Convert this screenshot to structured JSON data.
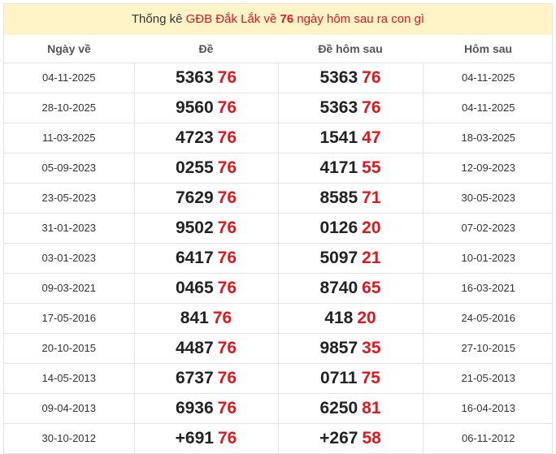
{
  "title": {
    "prefix": "Thống kê ",
    "province": "GĐB Đắk Lắk",
    "middle": " về ",
    "number": "76",
    "suffix": " ngày hôm sau ra con gì"
  },
  "columns": [
    "Ngày về",
    "Đề",
    "Đề hôm sau",
    "Hôm sau"
  ],
  "rows": [
    {
      "date": "04-11-2025",
      "de_head": "5363",
      "de_tail": "76",
      "next_head": "5363",
      "next_tail": "76",
      "next_date": "04-11-2025"
    },
    {
      "date": "28-10-2025",
      "de_head": "9560",
      "de_tail": "76",
      "next_head": "5363",
      "next_tail": "76",
      "next_date": "04-11-2025"
    },
    {
      "date": "11-03-2025",
      "de_head": "4723",
      "de_tail": "76",
      "next_head": "1541",
      "next_tail": "47",
      "next_date": "18-03-2025"
    },
    {
      "date": "05-09-2023",
      "de_head": "0255",
      "de_tail": "76",
      "next_head": "4171",
      "next_tail": "55",
      "next_date": "12-09-2023"
    },
    {
      "date": "23-05-2023",
      "de_head": "7629",
      "de_tail": "76",
      "next_head": "8585",
      "next_tail": "71",
      "next_date": "30-05-2023"
    },
    {
      "date": "31-01-2023",
      "de_head": "9502",
      "de_tail": "76",
      "next_head": "0126",
      "next_tail": "20",
      "next_date": "07-02-2023"
    },
    {
      "date": "03-01-2023",
      "de_head": "6417",
      "de_tail": "76",
      "next_head": "5097",
      "next_tail": "21",
      "next_date": "10-01-2023"
    },
    {
      "date": "09-03-2021",
      "de_head": "0465",
      "de_tail": "76",
      "next_head": "8740",
      "next_tail": "65",
      "next_date": "16-03-2021"
    },
    {
      "date": "17-05-2016",
      "de_head": "841",
      "de_tail": "76",
      "next_head": "418",
      "next_tail": "20",
      "next_date": "24-05-2016"
    },
    {
      "date": "20-10-2015",
      "de_head": "4487",
      "de_tail": "76",
      "next_head": "9857",
      "next_tail": "35",
      "next_date": "27-10-2015"
    },
    {
      "date": "14-05-2013",
      "de_head": "6737",
      "de_tail": "76",
      "next_head": "0711",
      "next_tail": "75",
      "next_date": "21-05-2013"
    },
    {
      "date": "09-04-2013",
      "de_head": "6936",
      "de_tail": "76",
      "next_head": "6250",
      "next_tail": "81",
      "next_date": "16-04-2013"
    },
    {
      "date": "30-10-2012",
      "de_head": "+691",
      "de_tail": "76",
      "next_head": "+267",
      "next_tail": "58",
      "next_date": "06-11-2012"
    }
  ],
  "colors": {
    "header_bg": "#fff4c8",
    "accent_red": "#e0171c",
    "border": "#e4e4e4"
  }
}
